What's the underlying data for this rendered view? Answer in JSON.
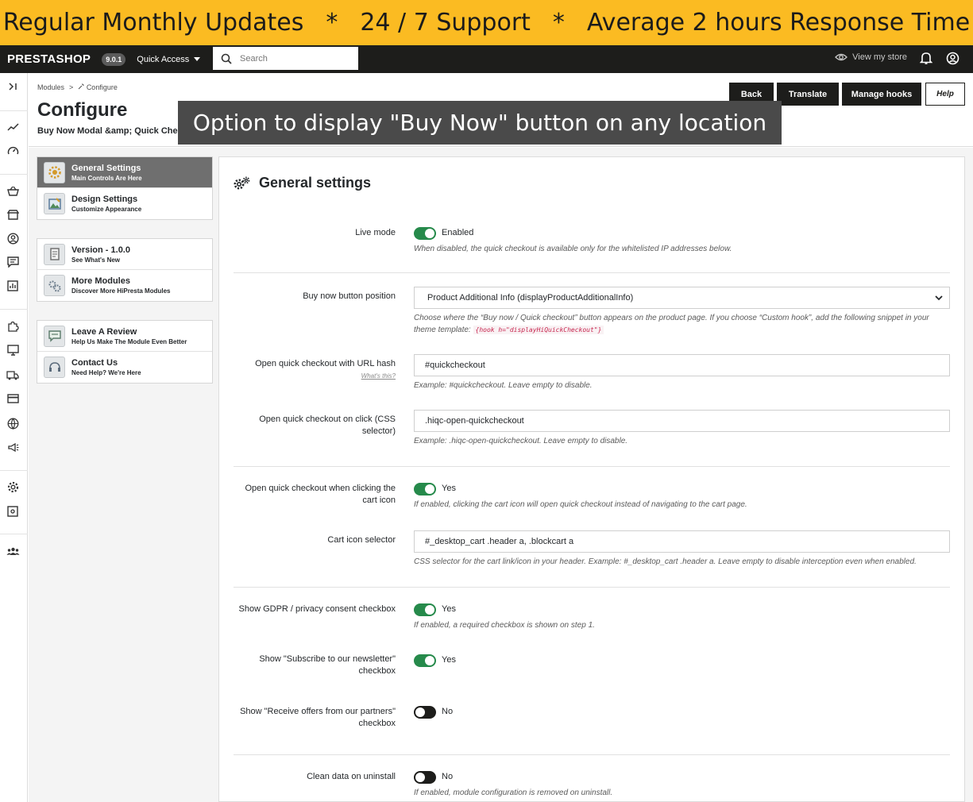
{
  "banner": {
    "part1": "Regular Monthly Updates",
    "sep": "*",
    "part2": "24 / 7 Support",
    "part3": "Average 2 hours Response Time"
  },
  "topbar": {
    "logo": "PRESTASHOP",
    "version": "9.0.1",
    "quick_access": "Quick Access",
    "search_placeholder": "Search",
    "view_store": "View my store"
  },
  "header": {
    "breadcrumb": [
      "Modules",
      ">",
      "Configure"
    ],
    "title": "Configure",
    "subtitle": "Buy Now Modal &amp; Quick Checkout",
    "buttons": {
      "back": "Back",
      "translate": "Translate",
      "manage_hooks": "Manage hooks",
      "help": "Help"
    }
  },
  "overlay_text": "Option to display \"Buy Now\" button on any location",
  "sidebar": {
    "groups": [
      [
        {
          "title": "General Settings",
          "sub": "Main Controls Are Here"
        },
        {
          "title": "Design Settings",
          "sub": "Customize Appearance"
        }
      ],
      [
        {
          "title": "Version - 1.0.0",
          "sub": "See What's New"
        },
        {
          "title": "More Modules",
          "sub": "Discover More HiPresta Modules"
        }
      ],
      [
        {
          "title": "Leave A Review",
          "sub": "Help Us Make The Module Even Better"
        },
        {
          "title": "Contact Us",
          "sub": "Need Help? We're Here"
        }
      ]
    ]
  },
  "panel": {
    "title": "General settings",
    "live_mode": {
      "label": "Live mode",
      "state": "Enabled",
      "help": "When disabled, the quick checkout is available only for the whitelisted IP addresses below."
    },
    "buy_now_position": {
      "label": "Buy now button position",
      "value": "Product Additional Info (displayProductAdditionalInfo)",
      "help": "Choose where the “Buy now / Quick checkout” button appears on the product page. If you choose “Custom hook”, add the following snippet in your theme template:",
      "code": "{hook h=\"displayHiQuickCheckout\"}"
    },
    "url_hash": {
      "label": "Open quick checkout with URL hash",
      "whats_this": "What's this?",
      "value": "#quickcheckout",
      "help": "Example: #quickcheckout. Leave empty to disable."
    },
    "css_selector": {
      "label": "Open quick checkout on click (CSS selector)",
      "value": ".hiqc-open-quickcheckout",
      "help": "Example: .hiqc-open-quickcheckout. Leave empty to disable."
    },
    "cart_icon": {
      "label": "Open quick checkout when clicking the cart icon",
      "state": "Yes",
      "help": "If enabled, clicking the cart icon will open quick checkout instead of navigating to the cart page."
    },
    "cart_selector": {
      "label": "Cart icon selector",
      "value": "#_desktop_cart .header a, .blockcart a",
      "help": "CSS selector for the cart link/icon in your header. Example: #_desktop_cart .header a. Leave empty to disable interception even when enabled."
    },
    "gdpr": {
      "label": "Show GDPR / privacy consent checkbox",
      "state": "Yes",
      "help": "If enabled, a required checkbox is shown on step 1."
    },
    "newsletter": {
      "label": "Show \"Subscribe to our newsletter\" checkbox",
      "state": "Yes"
    },
    "partners": {
      "label": "Show \"Receive offers from our partners\" checkbox",
      "state": "No"
    },
    "clean_data": {
      "label": "Clean data on uninstall",
      "state": "No",
      "help": "If enabled, module configuration is removed on uninstall."
    }
  }
}
